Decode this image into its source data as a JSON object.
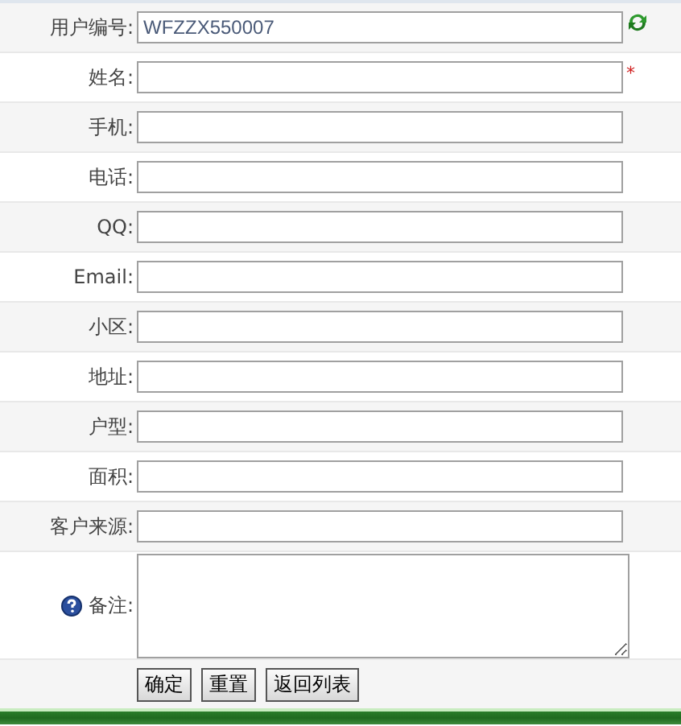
{
  "fields": [
    {
      "label": "用户编号:",
      "kind": "code",
      "value": "WFZZX550007"
    },
    {
      "label": "姓名:",
      "kind": "text",
      "suffix": "*"
    },
    {
      "label": "手机:",
      "kind": "text"
    },
    {
      "label": "电话:",
      "kind": "text"
    },
    {
      "label": "QQ:",
      "kind": "text"
    },
    {
      "label": "Email:",
      "kind": "text"
    },
    {
      "label": "小区:",
      "kind": "text"
    },
    {
      "label": "地址:",
      "kind": "text"
    },
    {
      "label": "户型:",
      "kind": "text"
    },
    {
      "label": "面积:",
      "kind": "text"
    },
    {
      "label": "客户来源:",
      "kind": "text"
    },
    {
      "label": "备注:",
      "kind": "notes"
    }
  ],
  "buttons": [
    "确定",
    "重置",
    "返回列表"
  ]
}
